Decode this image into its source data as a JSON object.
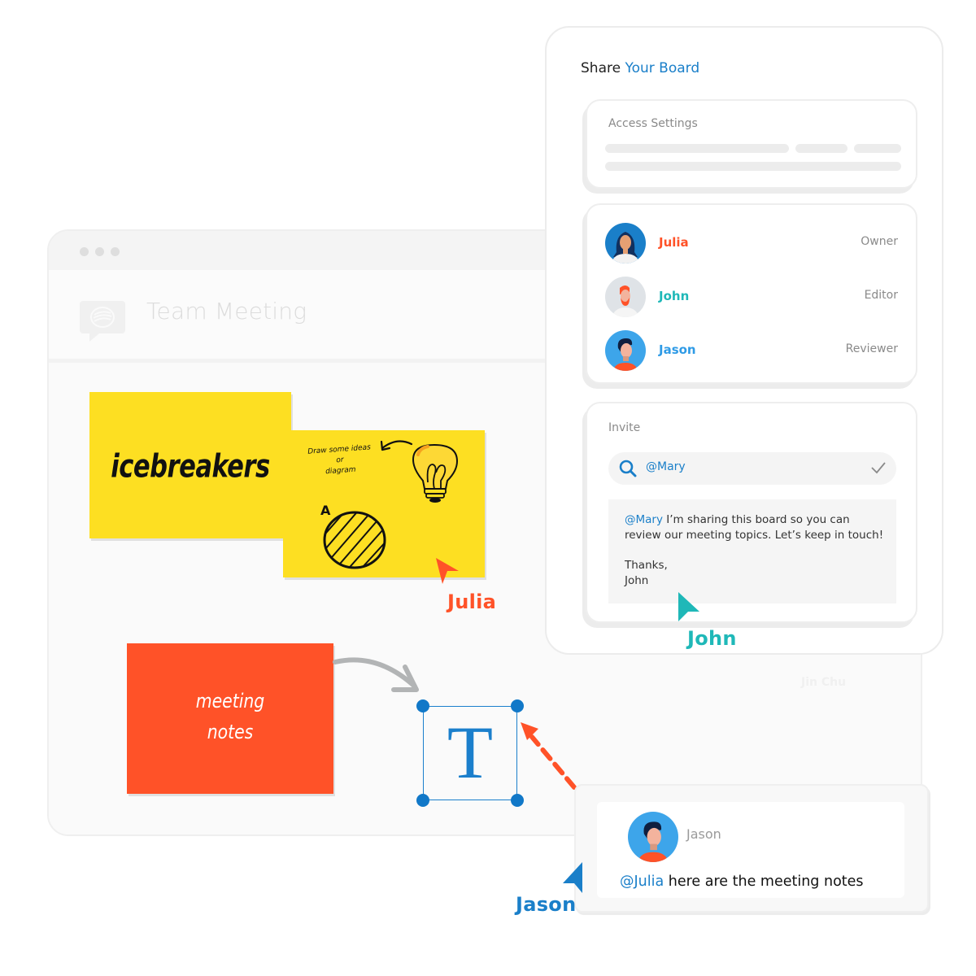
{
  "colors": {
    "accent_blue": "#1a7fc9",
    "julia": "#ff5228",
    "john": "#1fb8b8",
    "jason": "#1a7fc9",
    "sticky_yellow": "#fddf22",
    "sticky_orange": "#ff5228"
  },
  "board": {
    "title": "Team Meeting",
    "logo_icon": "chat-bubble-icon",
    "ghost_collaborator": "Jin Chu"
  },
  "notes": {
    "icebreakers": "icebreakers",
    "draw_hint": [
      "Draw some ideas",
      "or",
      "diagram"
    ],
    "diagram_label": "A",
    "meeting_notes": [
      "meeting",
      "notes"
    ]
  },
  "text_object": {
    "glyph": "T"
  },
  "cursors": {
    "julia": "Julia",
    "john": "John",
    "jason": "Jason"
  },
  "share_panel": {
    "title_prefix": "Share",
    "title_accent": "Your Board",
    "access_settings_label": "Access Settings",
    "members": [
      {
        "name": "Julia",
        "role": "Owner",
        "color": "#ff5228"
      },
      {
        "name": "John",
        "role": "Editor",
        "color": "#1fb8b8"
      },
      {
        "name": "Jason",
        "role": "Reviewer",
        "color": "#2f9be6"
      }
    ],
    "invite": {
      "label": "Invite",
      "search_icon": "search-icon",
      "search_value": "@Mary",
      "confirm_icon": "checkmark-icon",
      "message_mention": "@Mary",
      "message_line1_rest": " I’m sharing this board so you can",
      "message_line2": "review our meeting topics. Let’s keep in touch!",
      "signoff_line1": "Thanks,",
      "signoff_line2": "John"
    }
  },
  "comment": {
    "author": "Jason",
    "mention": "@Julia",
    "text": " here are the meeting notes"
  }
}
